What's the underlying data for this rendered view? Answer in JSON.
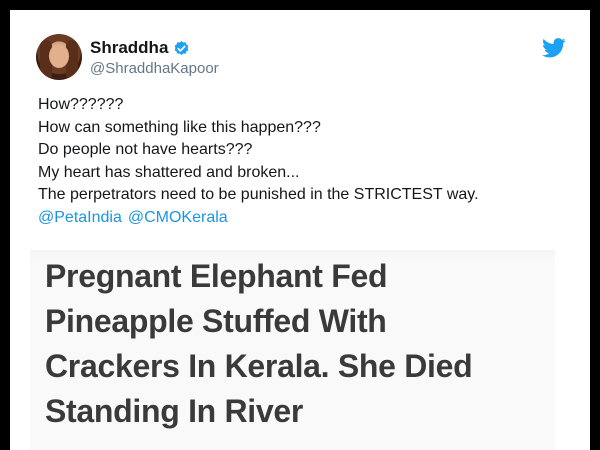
{
  "tweet": {
    "author_name": "Shraddha",
    "author_handle": "@ShraddhaKapoor",
    "lines": [
      "How??????",
      "How can something like this happen???",
      "Do people not have hearts???",
      "My heart has shattered and broken...",
      "The perpetrators need to be punished in the STRICTEST way."
    ],
    "mentions": [
      "@PetaIndia",
      "@CMOKerala"
    ]
  },
  "card": {
    "headline_lines": [
      "Pregnant Elephant Fed",
      "Pineapple Stuffed With",
      "Crackers In Kerala. She Died",
      "Standing In River"
    ]
  },
  "icons": {
    "verified": "verified-badge-icon",
    "brand": "twitter-bird-icon"
  },
  "colors": {
    "link": "#1b95e0",
    "verified": "#1da1f2",
    "handle": "#657786"
  }
}
